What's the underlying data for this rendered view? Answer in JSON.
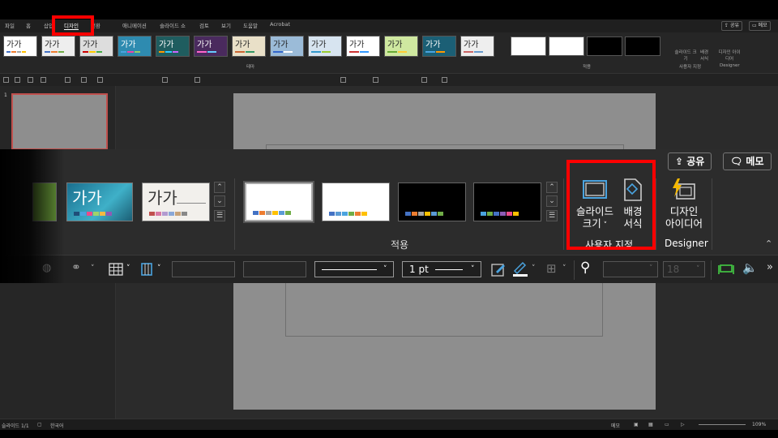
{
  "menu": {
    "items": [
      "파일",
      "홈",
      "삽입",
      "디자인",
      "전환",
      "애니메이션",
      "슬라이드 쇼",
      "검토",
      "보기",
      "도움말",
      "Acrobat"
    ],
    "active": "디자인",
    "share": "공유",
    "memo": "메모"
  },
  "ribbon": {
    "themes_label": "테마",
    "theme_glyph": "가가",
    "variants_label": "적용",
    "custom_group_label": "사용자 지정",
    "slide_size_small": "슬라이드 크기",
    "bg_format_small": "배경 서식",
    "designer_small": "디자인 아이디어",
    "designer_group": "Designer"
  },
  "zoom": {
    "share_label": "공유",
    "memo_label": "메모",
    "theme_glyph": "가가",
    "variants_group_label": "적용",
    "slide_size_line1": "슬라이드",
    "slide_size_line2": "크기",
    "bg_format_line1": "배경",
    "bg_format_line2": "서식",
    "custom_group_label": "사용자 지정",
    "designer_line1": "디자인",
    "designer_line2": "아이디어",
    "designer_group_label": "Designer",
    "line_weight": "1 pt",
    "font_size": "18"
  },
  "slides": {
    "thumb_number": "1"
  },
  "status": {
    "slide_count": "슬라이드 1/1",
    "language": "한국어",
    "notes": "메모",
    "zoom_level": "109%"
  },
  "colors": {
    "highlight": "#ff0000",
    "accent_blue": "#4aa3df"
  }
}
